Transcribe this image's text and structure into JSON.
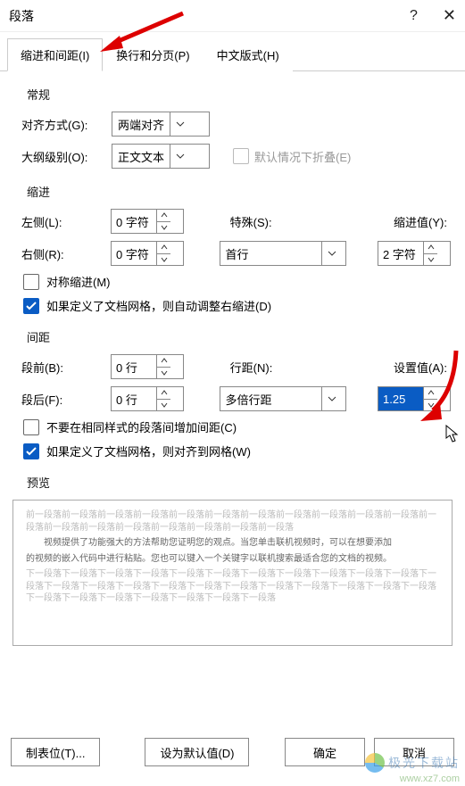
{
  "dialog_title": "段落",
  "tabs": {
    "t0": "缩进和间距(I)",
    "t1": "换行和分页(P)",
    "t2": "中文版式(H)"
  },
  "sections": {
    "general": "常规",
    "indent": "缩进",
    "spacing": "间距",
    "preview": "预览"
  },
  "general": {
    "align_label": "对齐方式(G):",
    "align_value": "两端对齐",
    "outline_label": "大纲级别(O):",
    "outline_value": "正文文本",
    "collapse_label": "默认情况下折叠(E)"
  },
  "indent": {
    "left_label": "左侧(L):",
    "left_value": "0 字符",
    "right_label": "右侧(R):",
    "right_value": "0 字符",
    "special_label": "特殊(S):",
    "special_value": "首行",
    "by_label": "缩进值(Y):",
    "by_value": "2 字符",
    "mirror_label": "对称缩进(M)",
    "autogrid_label": "如果定义了文档网格，则自动调整右缩进(D)"
  },
  "spacing": {
    "before_label": "段前(B):",
    "before_value": "0 行",
    "after_label": "段后(F):",
    "after_value": "0 行",
    "line_label": "行距(N):",
    "line_value": "多倍行距",
    "at_label": "设置值(A):",
    "at_value": "1.25",
    "noadd_label": "不要在相同样式的段落间增加间距(C)",
    "snap_label": "如果定义了文档网格，则对齐到网格(W)"
  },
  "preview_text": {
    "before": "前一段落前一段落前一段落前一段落前一段落前一段落前一段落前一段落前一段落前一段落前一段落前一段落前一段落前一段落前一段落前一段落前一段落前一段落前一段落",
    "mid1": "视频提供了功能强大的方法帮助您证明您的观点。当您单击联机视频时，可以在想要添加",
    "mid2": "的视频的嵌入代码中进行粘贴。您也可以键入一个关键字以联机搜索最适合您的文档的视频。",
    "after": "下一段落下一段落下一段落下一段落下一段落下一段落下一段落下一段落下一段落下一段落下一段落下一段落下一段落下一段落下一段落下一段落下一段落下一段落下一段落下一段落下一段落下一段落下一段落下一段落下一段落下一段落下一段落下一段落下一段落下一段落"
  },
  "buttons": {
    "tabs": "制表位(T)...",
    "default": "设为默认值(D)",
    "ok": "确定",
    "cancel": "取消"
  },
  "watermark": {
    "name": "极光下载站",
    "url": "www.xz7.com"
  }
}
